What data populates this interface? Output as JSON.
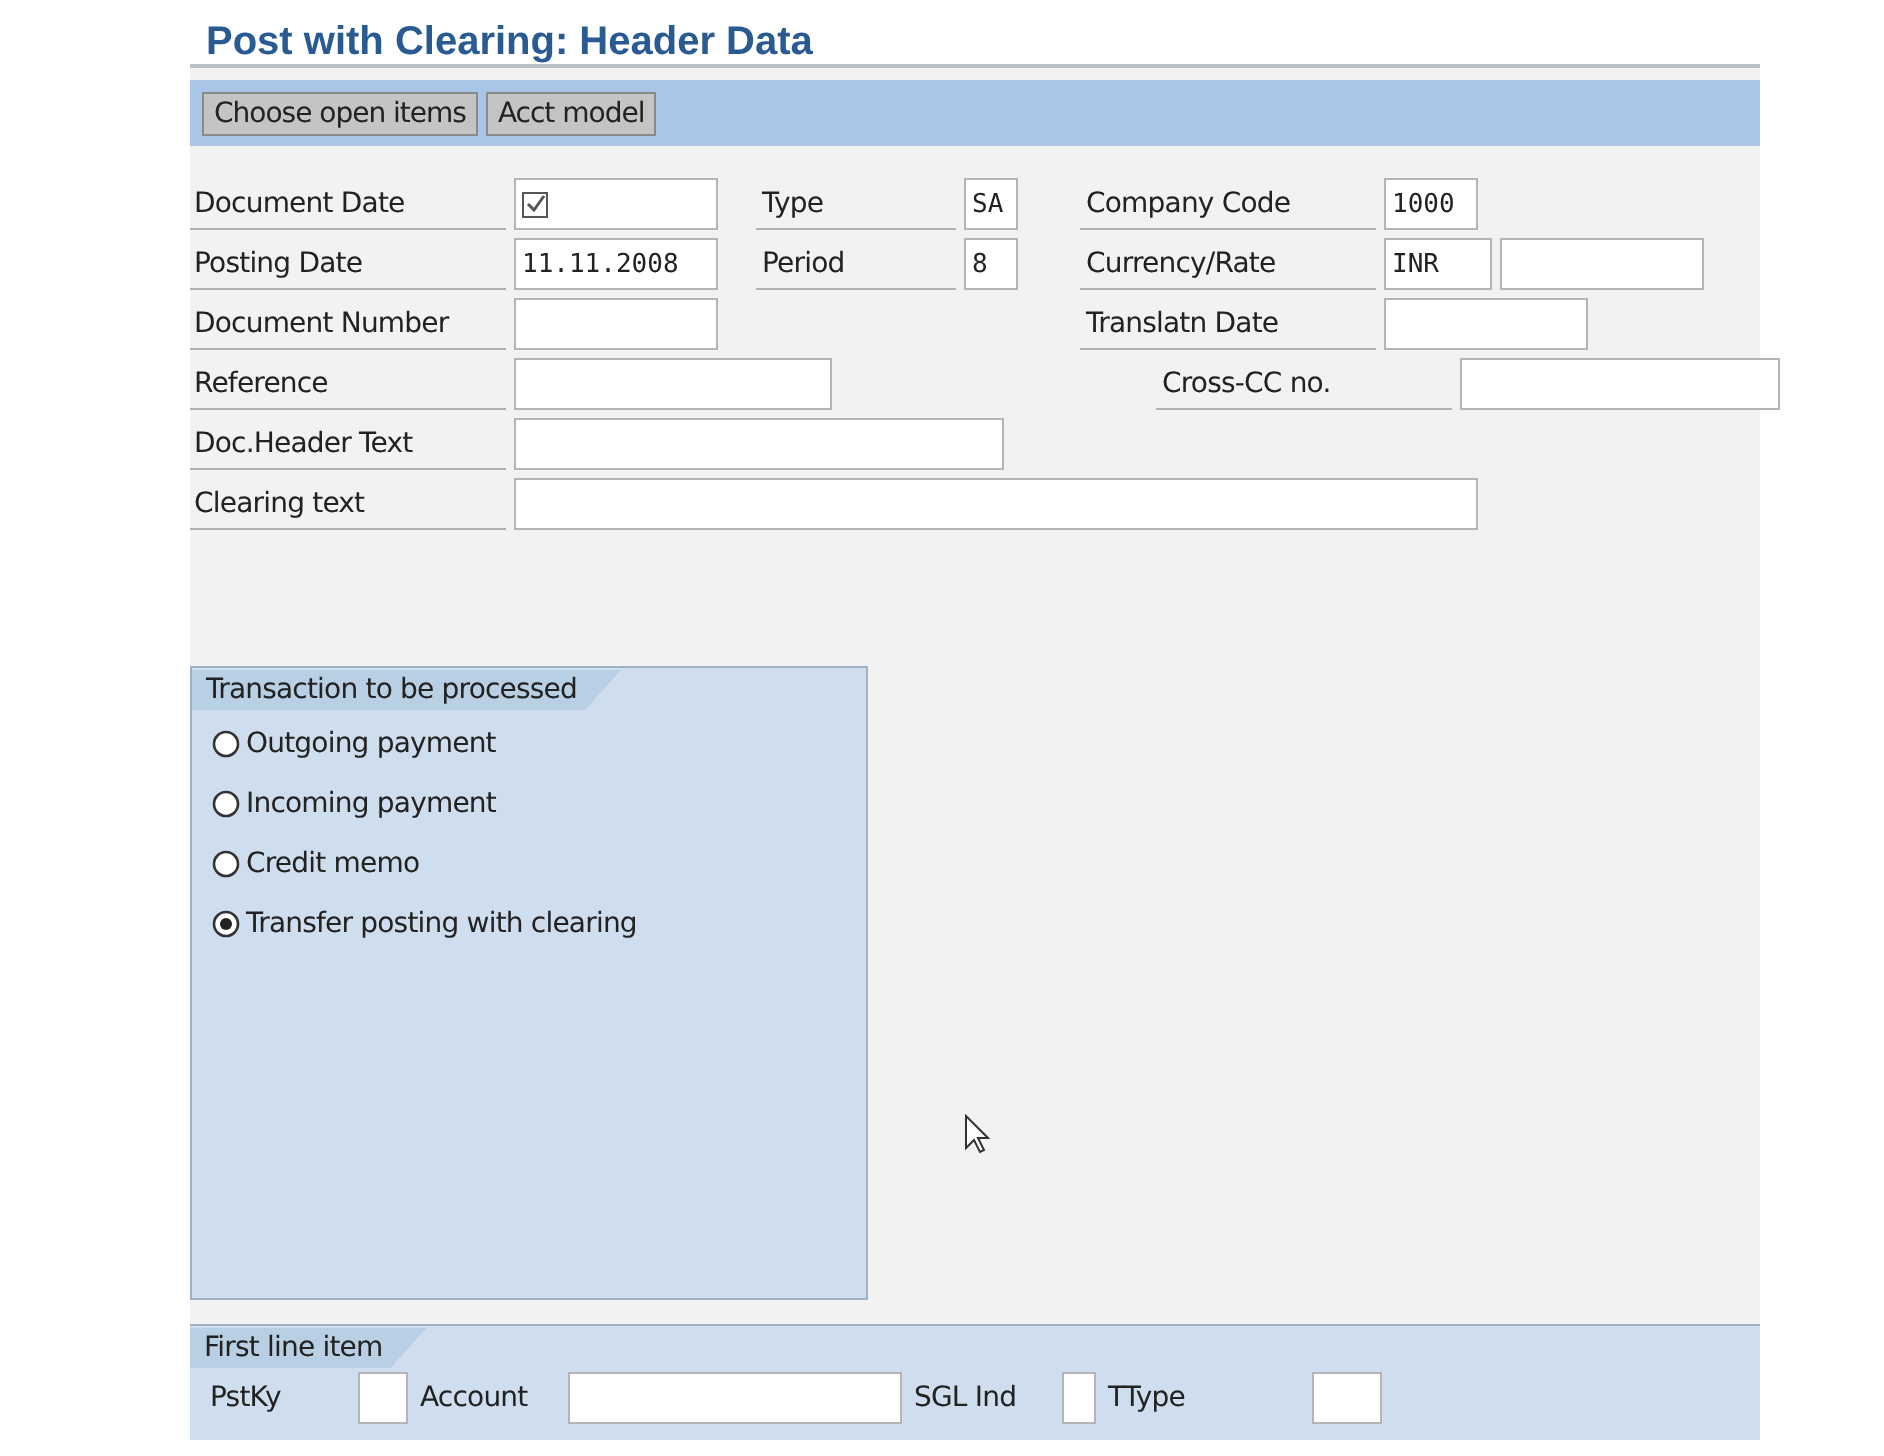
{
  "title": "Post with Clearing: Header Data",
  "toolbar": [
    "Choose open items",
    "Acct model"
  ],
  "rows": [
    {
      "left": {
        "label": "Document Date",
        "fields": [
          {
            "kind": "check_icon"
          }
        ]
      },
      "middle": {
        "label": "Type",
        "fields": [
          {
            "kind": "text",
            "value": "SA"
          }
        ]
      },
      "right": {
        "label": "Company Code",
        "fields": [
          {
            "kind": "text",
            "value": "1000"
          }
        ]
      }
    },
    {
      "left": {
        "label": "Posting Date",
        "fields": [
          {
            "kind": "text",
            "value": "11.11.2008"
          }
        ]
      },
      "middle": {
        "label": "Period",
        "fields": [
          {
            "kind": "text",
            "value": "8"
          }
        ]
      },
      "right": {
        "label": "Currency/Rate",
        "fields": [
          {
            "kind": "text",
            "value": "INR"
          },
          {
            "kind": "text"
          }
        ]
      }
    },
    {
      "left": {
        "label": "Document Number",
        "fields": [
          {
            "kind": "text"
          }
        ]
      },
      "right": {
        "label": "Translatn Date",
        "fields": [
          {
            "kind": "text"
          }
        ]
      }
    },
    {
      "left": {
        "label": "Reference",
        "fields": [
          {
            "kind": "text"
          }
        ]
      },
      "right": {
        "label": "Cross-CC no.",
        "fields": [
          {
            "kind": "text"
          }
        ]
      }
    },
    {
      "left": {
        "label": "Doc.Header Text",
        "fields": [
          {
            "kind": "text"
          }
        ]
      }
    },
    {
      "left": {
        "label": "Clearing text",
        "fields": [
          {
            "kind": "text"
          }
        ]
      }
    }
  ],
  "transaction_group": {
    "title": "Transaction to be processed",
    "options": [
      {
        "label": "Outgoing payment",
        "selected": false
      },
      {
        "label": "Incoming payment",
        "selected": false
      },
      {
        "label": "Credit memo",
        "selected": false
      },
      {
        "label": "Transfer posting with clearing",
        "selected": true
      }
    ]
  },
  "first_line_item": {
    "title": "First line item",
    "fields": [
      {
        "label": "PstKy"
      },
      {
        "label": "Account"
      },
      {
        "label": "SGL Ind"
      },
      {
        "label": "TType"
      }
    ]
  }
}
